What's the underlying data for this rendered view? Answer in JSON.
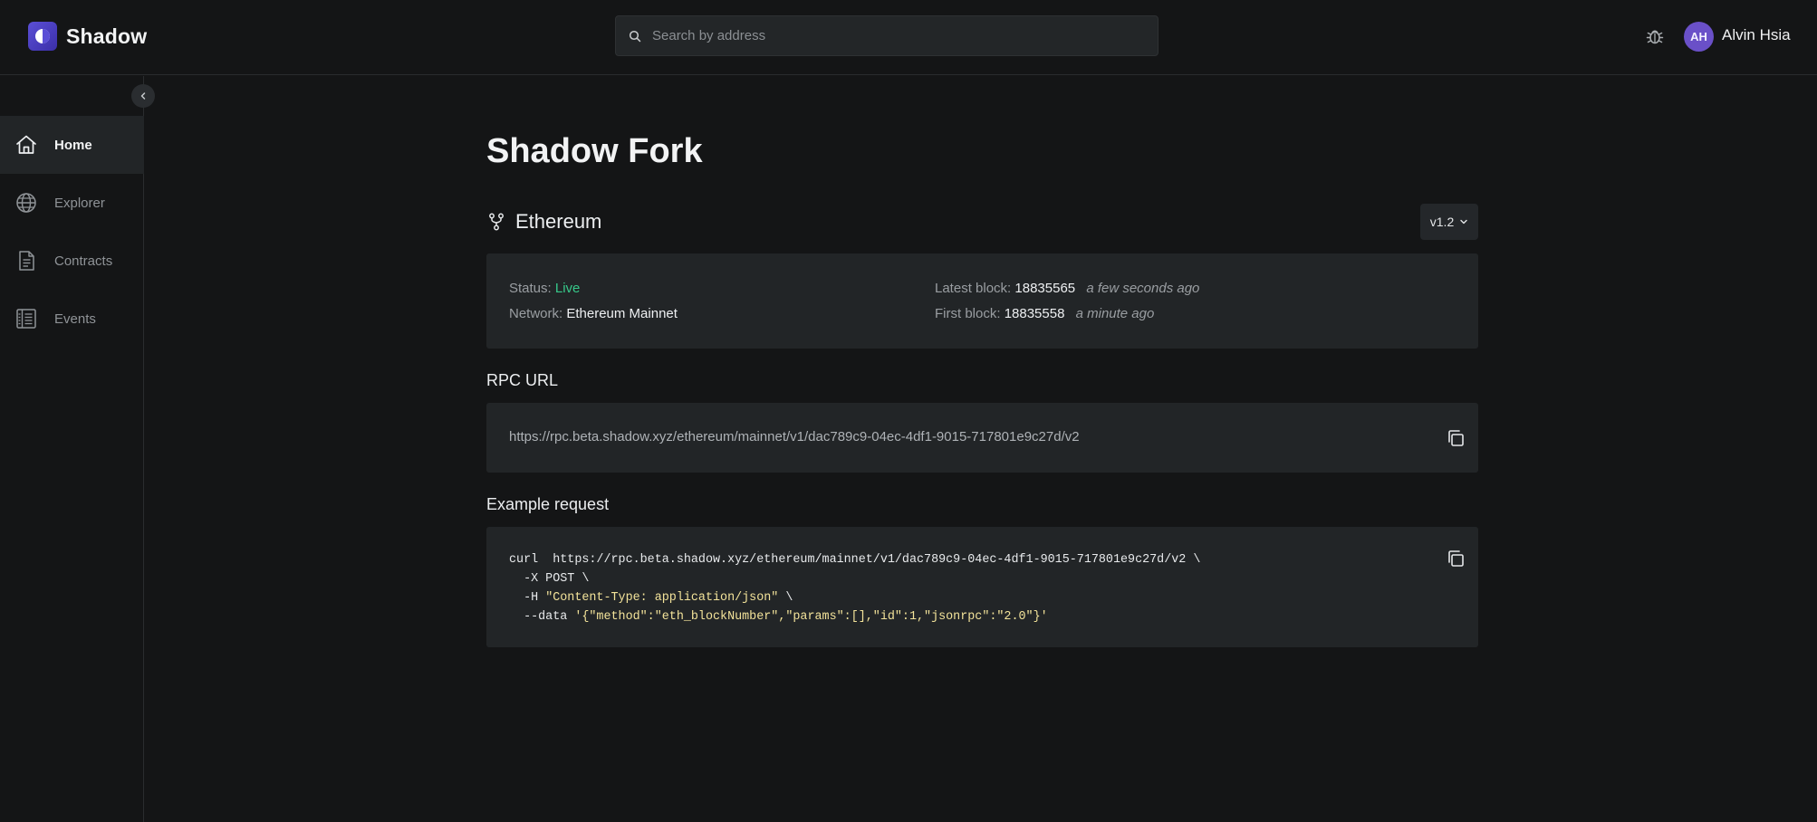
{
  "header": {
    "brand": "Shadow",
    "search_placeholder": "Search by address",
    "user_initials": "AH",
    "user_name": "Alvin Hsia"
  },
  "sidebar": {
    "items": [
      {
        "label": "Home",
        "icon": "home-icon",
        "active": true
      },
      {
        "label": "Explorer",
        "icon": "globe-icon",
        "active": false
      },
      {
        "label": "Contracts",
        "icon": "document-icon",
        "active": false
      },
      {
        "label": "Events",
        "icon": "events-list-icon",
        "active": false
      }
    ]
  },
  "main": {
    "title": "Shadow Fork",
    "chain_name": "Ethereum",
    "version": "v1.2",
    "status": {
      "status_label": "Status:",
      "status_value": "Live",
      "network_label": "Network:",
      "network_value": "Ethereum Mainnet",
      "latest_block_label": "Latest block:",
      "latest_block_value": "18835565",
      "latest_block_ago": "a few seconds ago",
      "first_block_label": "First block:",
      "first_block_value": "18835558",
      "first_block_ago": "a minute ago"
    },
    "rpc_heading": "RPC URL",
    "rpc_url": "https://rpc.beta.shadow.xyz/ethereum/mainnet/v1/dac789c9-04ec-4df1-9015-717801e9c27d/v2",
    "example_heading": "Example request",
    "code": {
      "line1": "curl  https://rpc.beta.shadow.xyz/ethereum/mainnet/v1/dac789c9-04ec-4df1-9015-717801e9c27d/v2 \\",
      "line2": "  -X POST \\",
      "line3_flag": "  -H ",
      "line3_str": "\"Content-Type: application/json\"",
      "line3_end": " \\",
      "line4_flag": "  --data ",
      "line4_str": "'{\"method\":\"eth_blockNumber\",\"params\":[],\"id\":1,\"jsonrpc\":\"2.0\"}'"
    }
  },
  "colors": {
    "background": "#141516",
    "panel": "#222527",
    "accent": "#6a50c8",
    "live": "#37c98a",
    "code_string": "#f3e39a"
  }
}
